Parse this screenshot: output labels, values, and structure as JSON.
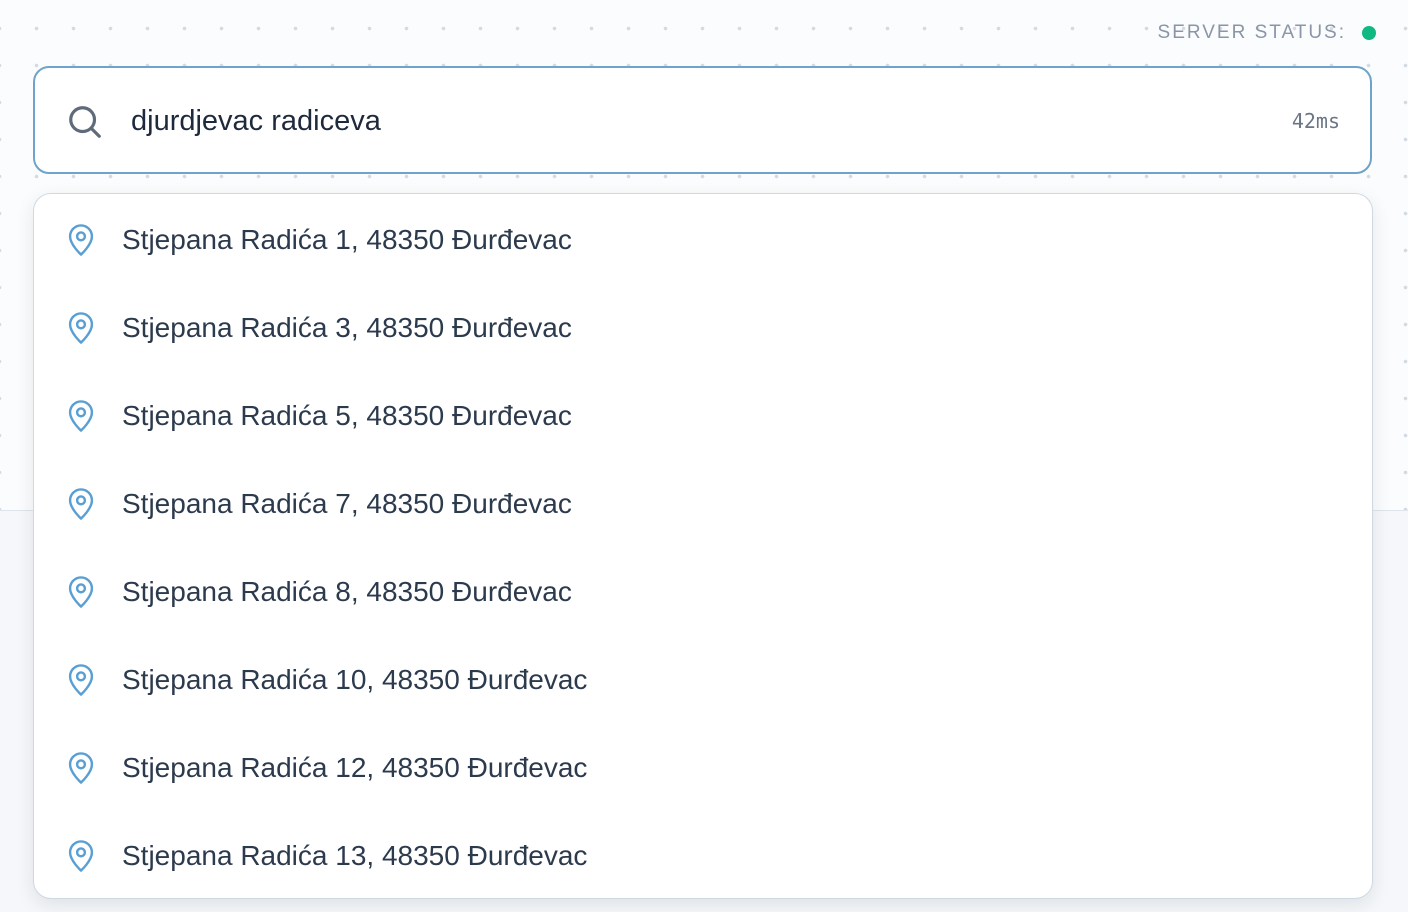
{
  "server_status": {
    "label": "SERVER STATUS:",
    "status_color": "#10b981"
  },
  "search": {
    "icon": "search-icon",
    "value": "djurdjevac radiceva",
    "latency": "42ms"
  },
  "results": [
    {
      "label": "Stjepana Radića 1, 48350 Đurđevac",
      "icon": "map-pin-icon"
    },
    {
      "label": "Stjepana Radića 3, 48350 Đurđevac",
      "icon": "map-pin-icon"
    },
    {
      "label": "Stjepana Radića 5, 48350 Đurđevac",
      "icon": "map-pin-icon"
    },
    {
      "label": "Stjepana Radića 7, 48350 Đurđevac",
      "icon": "map-pin-icon"
    },
    {
      "label": "Stjepana Radića 8, 48350 Đurđevac",
      "icon": "map-pin-icon"
    },
    {
      "label": "Stjepana Radića 10, 48350 Đurđevac",
      "icon": "map-pin-icon"
    },
    {
      "label": "Stjepana Radića 12, 48350 Đurđevac",
      "icon": "map-pin-icon"
    },
    {
      "label": "Stjepana Radića 13, 48350 Đurđevac",
      "icon": "map-pin-icon"
    }
  ],
  "colors": {
    "accent": "#6fa3c9",
    "pin": "#5a9fd4",
    "text": "#2c3a4d"
  }
}
